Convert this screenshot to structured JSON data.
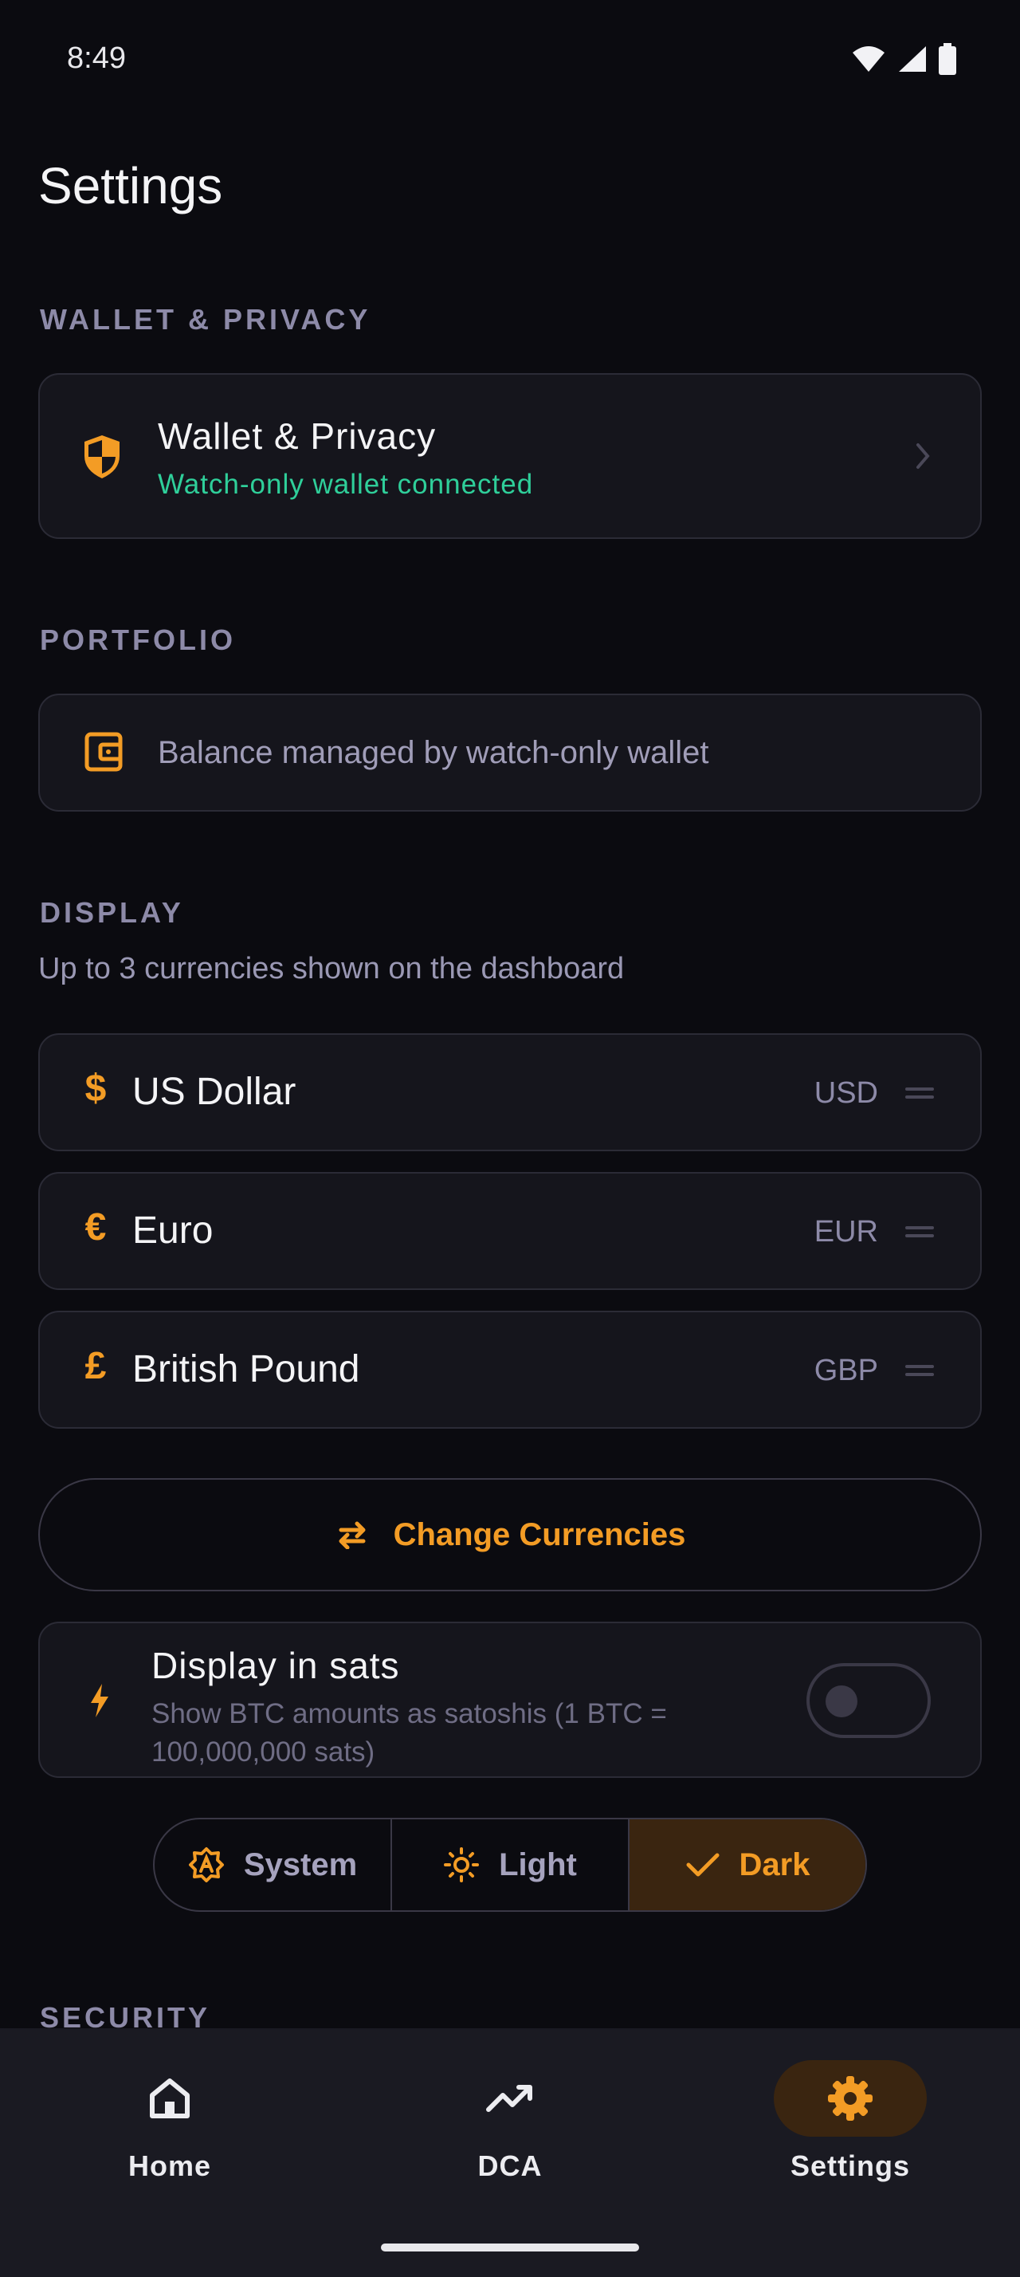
{
  "status_bar": {
    "time": "8:49"
  },
  "page": {
    "title": "Settings"
  },
  "wallet_section": {
    "label": "WALLET & PRIVACY",
    "card_title": "Wallet & Privacy",
    "card_subtitle": "Watch-only wallet connected"
  },
  "portfolio_section": {
    "label": "PORTFOLIO",
    "card_text": "Balance managed by watch-only wallet"
  },
  "display_section": {
    "label": "DISPLAY",
    "description": "Up to 3 currencies shown on the dashboard",
    "currencies": [
      {
        "symbol": "$",
        "name": "US Dollar",
        "code": "USD"
      },
      {
        "symbol": "€",
        "name": "Euro",
        "code": "EUR"
      },
      {
        "symbol": "£",
        "name": "British Pound",
        "code": "GBP"
      }
    ],
    "change_button": "Change Currencies",
    "sats": {
      "title": "Display in sats",
      "description": "Show BTC amounts as satoshis (1 BTC = 100,000,000 sats)",
      "enabled": false
    },
    "theme": {
      "options": [
        "System",
        "Light",
        "Dark"
      ],
      "selected": "Dark"
    }
  },
  "security_section": {
    "label": "SECURITY"
  },
  "bottom_nav": {
    "items": [
      {
        "label": "Home",
        "icon": "home-icon"
      },
      {
        "label": "DCA",
        "icon": "trending-up-icon"
      },
      {
        "label": "Settings",
        "icon": "gear-icon"
      }
    ],
    "active": "Settings"
  },
  "colors": {
    "accent": "#f39c25",
    "success": "#2fcf9a",
    "background": "#0b0b10",
    "card": "#15151c"
  }
}
